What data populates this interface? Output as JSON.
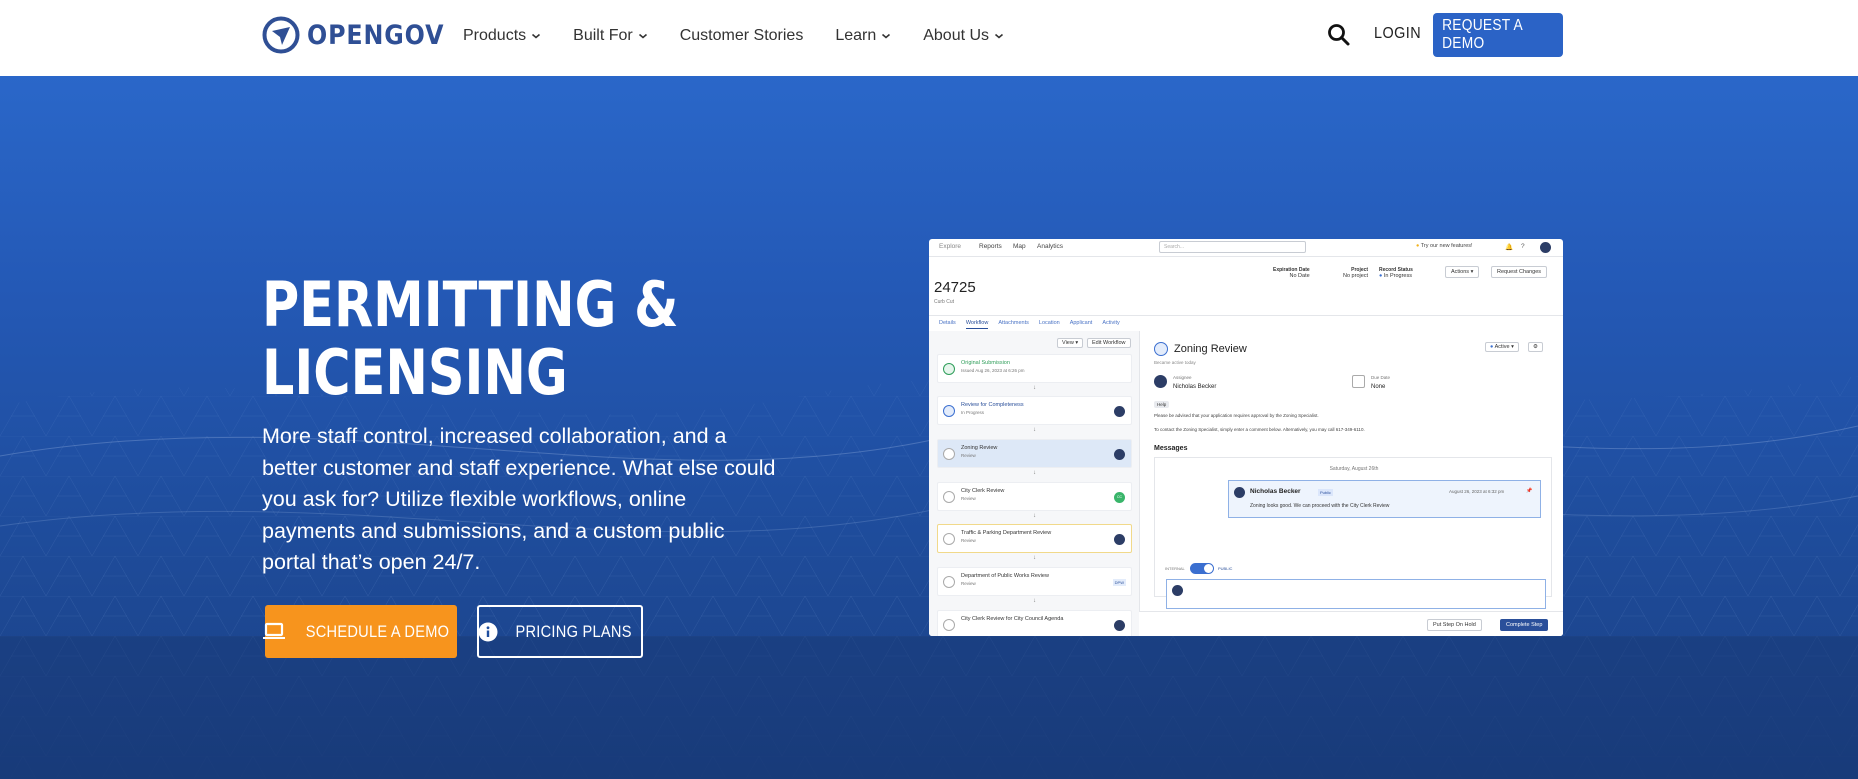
{
  "header": {
    "logo_text": "OPENGOV",
    "nav": [
      {
        "label": "Products",
        "has_dropdown": true
      },
      {
        "label": "Built For",
        "has_dropdown": true
      },
      {
        "label": "Customer Stories",
        "has_dropdown": false
      },
      {
        "label": "Learn",
        "has_dropdown": true
      },
      {
        "label": "About Us",
        "has_dropdown": true
      }
    ],
    "search_icon": "search-icon",
    "login_label": "LOGIN",
    "demo_label": "REQUEST A DEMO"
  },
  "hero": {
    "title_line1": "PERMITTING &",
    "title_line2": "LICENSING",
    "body": "More staff control, increased collaboration, and a better customer and staff experience. What else could you ask for? Utilize flexible workflows, online payments and submissions, and a custom public portal that’s open 24/7.",
    "primary_button": "SCHEDULE A DEMO",
    "secondary_button": "PRICING PLANS"
  },
  "app_preview": {
    "top_nav": [
      "Explore",
      "Reports",
      "Map",
      "Analytics"
    ],
    "search_placeholder": "Search...",
    "new_features": "Try our new features!",
    "record_number": "24725",
    "record_subtitle": "Curb Cut",
    "meta": [
      {
        "label": "Expiration Date",
        "value": "No Date"
      },
      {
        "label": "Project",
        "value": "No project"
      },
      {
        "label": "Record Status",
        "value": "In Progress"
      }
    ],
    "actions_label": "Actions",
    "request_changes_label": "Request Changes",
    "tabs": [
      "Details",
      "Workflow",
      "Attachments",
      "Location",
      "Applicant",
      "Activity"
    ],
    "view_label": "View",
    "edit_workflow_label": "Edit Workflow",
    "steps": [
      {
        "name": "Original Submission",
        "status": "Issued Aug 26, 2023 at 6:26 pm"
      },
      {
        "name": "Review for Completeness",
        "status": "In Progress"
      },
      {
        "name": "Zoning Review",
        "status": "Review"
      },
      {
        "name": "City Clerk Review",
        "status": "Review"
      },
      {
        "name": "Traffic & Parking Department Review",
        "status": "Review"
      },
      {
        "name": "Department of Public Works Review",
        "status": "Review"
      },
      {
        "name": "City Clerk Review for City Council Agenda",
        "status": ""
      }
    ],
    "step_badge_green": "CC",
    "step_badge_dpw": "DPW",
    "detail": {
      "title": "Zoning Review",
      "subtitle": "Became active today",
      "active_label": "Active",
      "assignee_label": "Assignee",
      "assignee_name": "Nicholas Becker",
      "due_label": "Due Date",
      "due_value": "None",
      "help_label": "Help",
      "note1": "Please be advised that your application requires approval by the Zoning Specialist.",
      "note2": "To contact the Zoning Specialist, simply enter a comment below. Alternatively, you may call 617-349-6110.",
      "messages_heading": "Messages",
      "date_divider": "Saturday, August 26th",
      "message_author": "Nicholas Becker",
      "message_tag": "Public",
      "message_time": "August 26, 2023 at 6:32 pm",
      "message_text": "Zoning looks good. We can proceed with the City Clerk Review",
      "toggle_left": "INTERNAL",
      "toggle_right": "PUBLIC",
      "hold_label": "Put Step On Hold",
      "complete_label": "Complete Step"
    }
  },
  "colors": {
    "brand_blue": "#2f4f95",
    "button_blue": "#2b63c6",
    "accent_orange": "#f7941d",
    "hero_top": "#2a67c9",
    "hero_bottom": "#1a3f82"
  }
}
